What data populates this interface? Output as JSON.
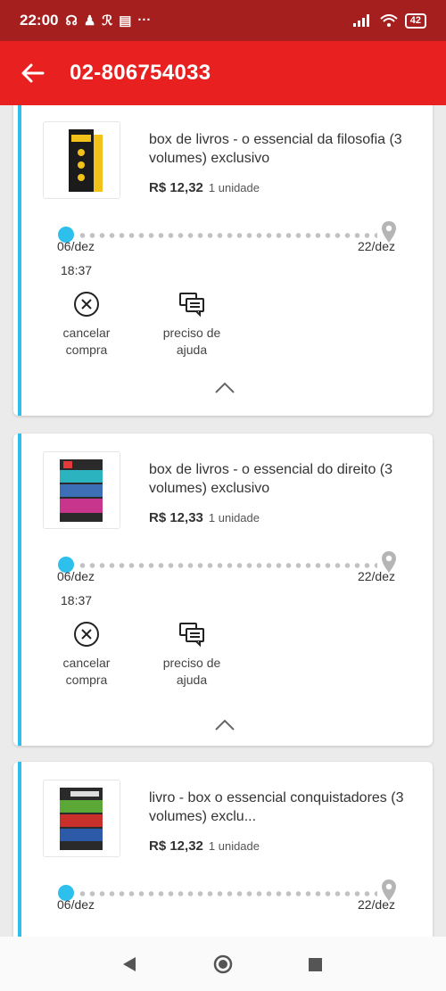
{
  "status_bar": {
    "time": "22:00",
    "dots": "···",
    "battery": "42"
  },
  "header": {
    "title": "02-806754033"
  },
  "orders": [
    {
      "title": "box de livros - o essencial da filosofia (3 volumes) exclusivo",
      "price": "R$ 12,32",
      "qty": "1 unidade",
      "date_start": "06/dez",
      "date_end": "22/dez",
      "time": "18:37",
      "cancel_label": "cancelar compra",
      "help_label": "preciso de ajuda"
    },
    {
      "title": "box de livros - o essencial do direito (3 volumes) exclusivo",
      "price": "R$ 12,33",
      "qty": "1 unidade",
      "date_start": "06/dez",
      "date_end": "22/dez",
      "time": "18:37",
      "cancel_label": "cancelar compra",
      "help_label": "preciso de ajuda"
    },
    {
      "title": "livro - box o essencial conquistadores (3 volumes) exclu...",
      "price": "R$ 12,32",
      "qty": "1 unidade",
      "date_start": "06/dez",
      "date_end": "22/dez"
    }
  ],
  "colors": {
    "status_bar": "#a51f1f",
    "app_bar": "#e8201f",
    "accent": "#2ec0ec"
  }
}
